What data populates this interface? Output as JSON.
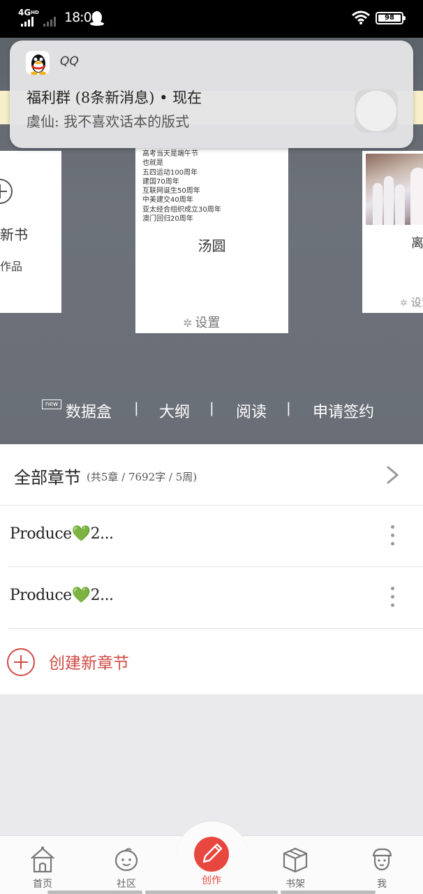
{
  "status_bar": {
    "network": "4G",
    "network_sup": "HD",
    "time": "18:00",
    "battery": "98"
  },
  "notification": {
    "app_name": "QQ",
    "title": "福利群 (8条新消息) • 现在",
    "message": "虞仙: 我不喜欢话本的版式"
  },
  "cards": {
    "left": {
      "title": "新书",
      "subtitle": "作品"
    },
    "middle": {
      "lines": [
        "高考当天是端午节",
        "也就是",
        "五四运动100周年",
        "建国70周年",
        "互联网诞生50周年",
        "中美建交40周年",
        "亚太经合组织成立30周年",
        "澳门回归20周年"
      ],
      "name": "汤圆",
      "settings": "设置"
    },
    "right": {
      "title": "离",
      "settings": "设置"
    }
  },
  "hero_nav": {
    "new_badge": "new",
    "items": [
      "数据盒",
      "大纲",
      "阅读",
      "申请签约"
    ],
    "separator": "|"
  },
  "chapters": {
    "all_label": "全部章节",
    "all_meta": "(共5章 / 7692字 / 5周)",
    "rows": [
      {
        "prefix": "Produce",
        "heart": "💚",
        "suffix": "2..."
      },
      {
        "prefix": "Produce",
        "heart": "💚",
        "suffix": "2..."
      }
    ],
    "create_label": "创建新章节"
  },
  "bottom_nav": {
    "tabs": [
      "首页",
      "社区",
      "创作",
      "书架",
      "我"
    ],
    "active": "创作",
    "active_color": "#e8473f"
  }
}
